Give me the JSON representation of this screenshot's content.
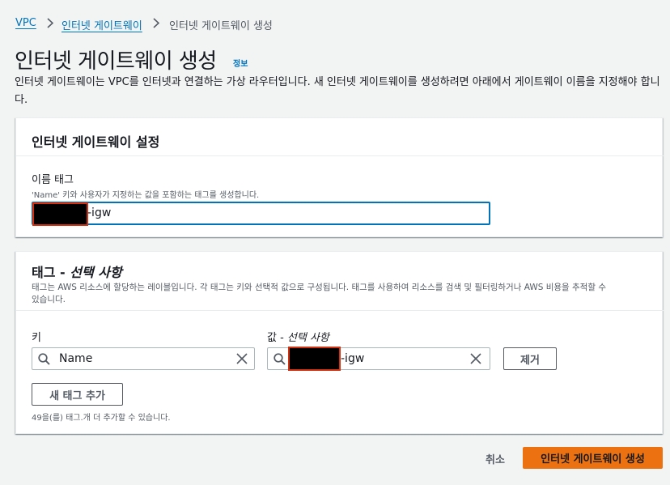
{
  "breadcrumb": {
    "items": [
      "VPC",
      "인터넷 게이트웨이"
    ],
    "current": "인터넷 게이트웨이 생성"
  },
  "page": {
    "title": "인터넷 게이트웨이 생성",
    "info_label": "정보",
    "description_line1": "인터넷 게이트웨이는 VPC를 인터넷과 연결하는 가상 라우터입니다. 새 인터넷 게이트웨이를 생성하려면 아래에서 게이트웨이 이름을 지정해야 합니",
    "description_line2": "다."
  },
  "settings_panel": {
    "title": "인터넷 게이트웨이 설정",
    "name_tag_label": "이름 태그",
    "name_tag_hint": "'Name' 키와 사용자가 지정하는 값을 포함하는 태그를 생성합니다.",
    "name_tag_value_suffix": "-igw"
  },
  "tags_panel": {
    "title_prefix": "태그 - ",
    "title_optional": "선택 사항",
    "description_line1": "태그는 AWS 리소스에 할당하는 레이블입니다. 각 태그는 키와 선택적 값으로 구성됩니다. 태그를 사용하여 리소스를 검색 및 필터링하거나 AWS 비용을 추적할 수",
    "description_line2": "있습니다.",
    "key_label": "키",
    "value_label_prefix": "값 - ",
    "value_label_optional": "선택 사항",
    "key_value": "Name",
    "value_suffix": "-igw",
    "remove_button": "제거",
    "add_tag_button": "새 태그 추가",
    "remaining_text": "49을(를) 태그.개 더 추가할 수 있습니다."
  },
  "footer": {
    "cancel_button": "취소",
    "create_button": "인터넷 게이트웨이 생성"
  },
  "colors": {
    "link": "#0073bb",
    "primary_button": "#ec7211",
    "focus_border": "#0073bb",
    "redaction_border": "#d13212"
  },
  "icons": {
    "search": "search-icon",
    "clear": "close-icon",
    "separator": "chevron-right-icon"
  }
}
